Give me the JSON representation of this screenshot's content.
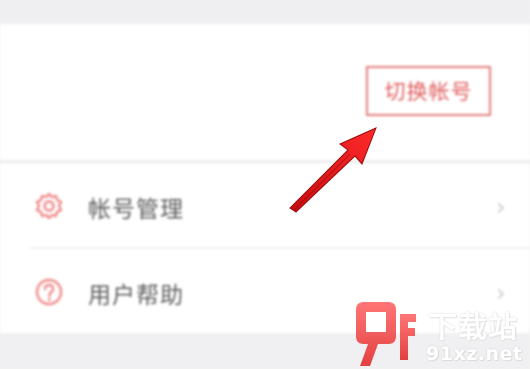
{
  "account": {
    "switch_button_label": "切换帐号"
  },
  "menu": {
    "items": [
      {
        "label": "帐号管理",
        "icon": "gear-icon",
        "chevron": "›"
      },
      {
        "label": "用户帮助",
        "icon": "help-icon",
        "chevron": "›"
      }
    ]
  },
  "watermark": {
    "title": "下载站",
    "domain": "91xz.net",
    "logo_text": "9f"
  },
  "colors": {
    "accent": "#e05a5a",
    "arrow": "#e0161a",
    "icon_stroke": "#f08a8a",
    "background": "#f2f2f4"
  }
}
